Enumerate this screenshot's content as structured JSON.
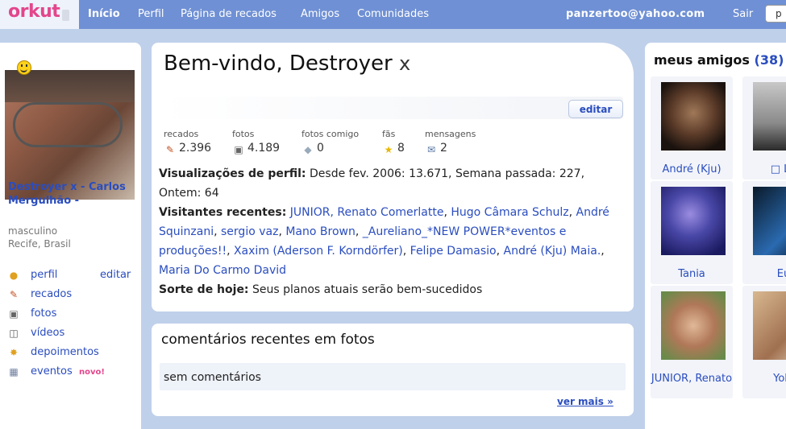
{
  "topbar": {
    "logo": "orkut",
    "nav": [
      "Início",
      "Perfil",
      "Página de recados",
      "Amigos",
      "Comunidades"
    ],
    "user_email": "panzertoo@yahoo.com",
    "logout": "Sair",
    "search_value": "p"
  },
  "profile": {
    "name": "Destroyer x - Carlos Mergulhão -",
    "gender": "masculino",
    "location": "Recife, Brasil",
    "edit_label": "editar",
    "menu": [
      {
        "label": "perfil",
        "icon": "person-icon"
      },
      {
        "label": "recados",
        "icon": "note-icon"
      },
      {
        "label": "fotos",
        "icon": "camera-icon"
      },
      {
        "label": "vídeos",
        "icon": "video-icon"
      },
      {
        "label": "depoimentos",
        "icon": "badge-icon"
      },
      {
        "label": "eventos",
        "icon": "calendar-icon"
      }
    ],
    "new_badge": "novo!"
  },
  "welcome": {
    "title": "Bem-vindo, Destroyer",
    "title_suffix": "x",
    "edit_button": "editar",
    "stats": [
      {
        "label": "recados",
        "value": "2.396"
      },
      {
        "label": "fotos",
        "value": "4.189"
      },
      {
        "label": "fotos comigo",
        "value": "0"
      },
      {
        "label": "fãs",
        "value": "8"
      },
      {
        "label": "mensagens",
        "value": "2"
      }
    ],
    "views_label": "Visualizações de perfil:",
    "views_text": "Desde fev. 2006: 13.671, Semana passada: 227, Ontem: 64",
    "visitors_label": "Visitantes recentes:",
    "visitors": [
      "JUNIOR, Renato Comerlatte",
      "Hugo Câmara Schulz",
      "André Squinzani",
      "sergio vaz",
      "Mano Brown",
      "_Aureliano_*NEW POWER*eventos e produções!!",
      "Xaxim (Aderson F. Korndörfer)",
      "Felipe Damasio",
      "André (Kju) Maia.",
      "Maria Do Carmo David"
    ],
    "luck_label": "Sorte de hoje:",
    "luck_text": "Seus planos atuais serão bem-sucedidos"
  },
  "comments": {
    "title": "comentários recentes em fotos",
    "empty": "sem comentários",
    "more": "ver mais »"
  },
  "friends": {
    "title": "meus amigos",
    "count": "(38)",
    "items": [
      {
        "name": "André (Kju)"
      },
      {
        "name": "□ LU"
      },
      {
        "name": "Tania"
      },
      {
        "name": "Eu"
      },
      {
        "name": "JUNIOR, Renato"
      },
      {
        "name": "Yola"
      }
    ]
  }
}
